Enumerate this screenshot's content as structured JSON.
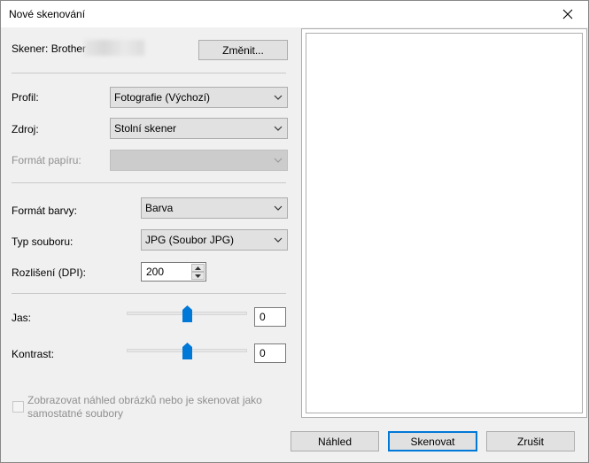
{
  "window": {
    "title": "Nové skenování"
  },
  "scanner": {
    "label": "Skener: Brother",
    "change_button": "Změnit..."
  },
  "profile": {
    "label": "Profil:",
    "value": "Fotografie (Výchozí)"
  },
  "source": {
    "label": "Zdroj:",
    "value": "Stolní skener"
  },
  "paper_format": {
    "label": "Formát papíru:",
    "value": ""
  },
  "color_format": {
    "label": "Formát barvy:",
    "value": "Barva"
  },
  "file_type": {
    "label": "Typ souboru:",
    "value": "JPG (Soubor JPG)"
  },
  "resolution": {
    "label": "Rozlišení (DPI):",
    "value": "200"
  },
  "brightness": {
    "label": "Jas:",
    "value": "0",
    "level": 0.5
  },
  "contrast": {
    "label": "Kontrast:",
    "value": "0",
    "level": 0.5
  },
  "separate_files": {
    "label": "Zobrazovat náhled obrázků nebo je skenovat jako samostatné soubory",
    "checked": false
  },
  "buttons": {
    "preview": "Náhled",
    "scan": "Skenovat",
    "cancel": "Zrušit"
  },
  "colors": {
    "accent": "#0078d7",
    "window_bg": "#f0f0f0"
  }
}
